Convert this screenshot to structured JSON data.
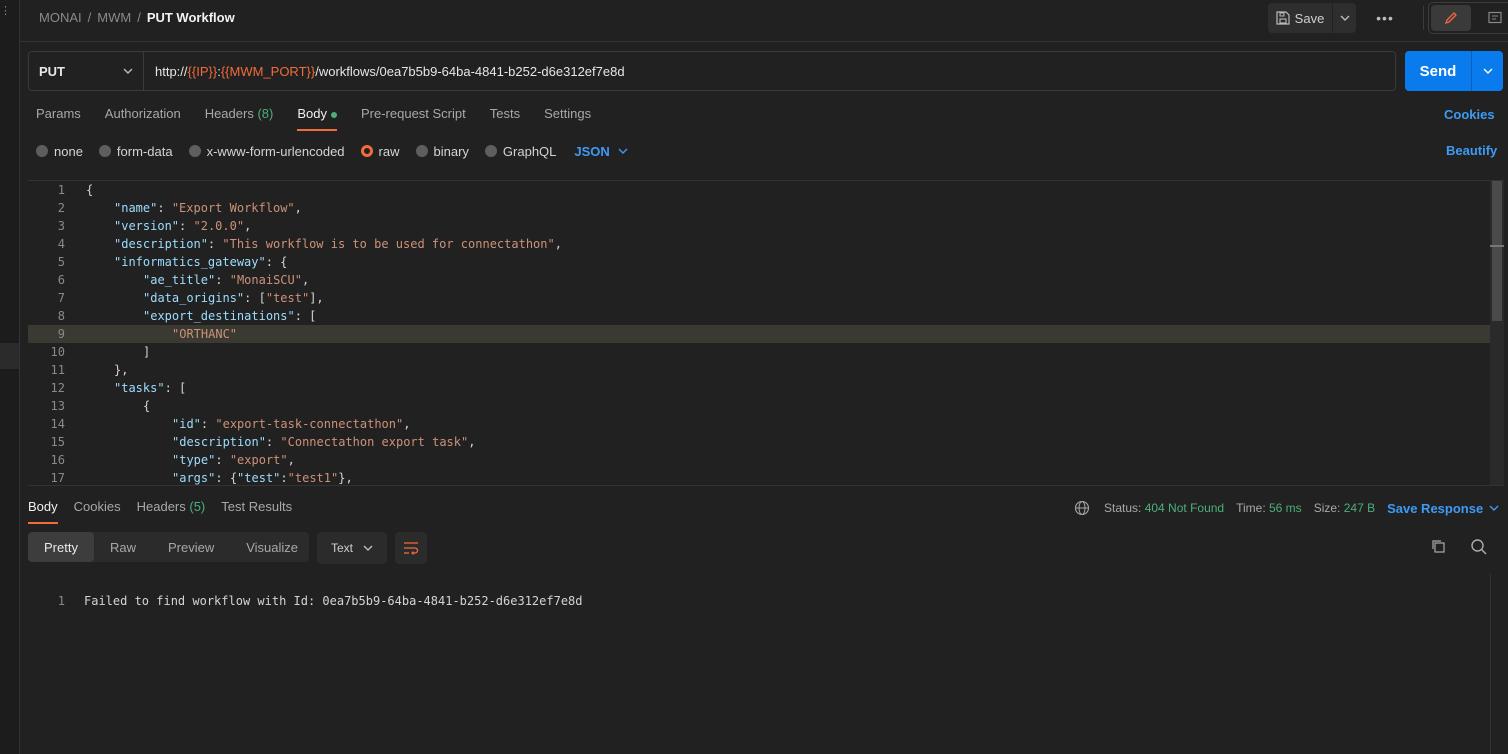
{
  "breadcrumb": {
    "part1": "MONAI",
    "part2": "MWM",
    "current": "PUT Workflow",
    "sep": "/"
  },
  "header": {
    "save_label": "Save",
    "more_label": "•••"
  },
  "request": {
    "method": "PUT",
    "url_prefix": "http://",
    "url_var1": "{{IP}}",
    "url_colon": ":",
    "url_var2": "{{MWM_PORT}}",
    "url_path": "/workflows/0ea7b5b9-64ba-4841-b252-d6e312ef7e8d",
    "send_label": "Send"
  },
  "req_tabs": {
    "params": "Params",
    "authorization": "Authorization",
    "headers": "Headers",
    "headers_count": "(8)",
    "body": "Body",
    "prerequest": "Pre-request Script",
    "tests": "Tests",
    "settings": "Settings",
    "cookies": "Cookies"
  },
  "body_options": {
    "none": "none",
    "form_data": "form-data",
    "urlencoded": "x-www-form-urlencoded",
    "raw": "raw",
    "binary": "binary",
    "graphql": "GraphQL",
    "language": "JSON",
    "beautify": "Beautify"
  },
  "editor_lines": [
    {
      "n": "1",
      "text": "{"
    },
    {
      "n": "2",
      "text": "\"name\": \"Export Workflow\","
    },
    {
      "n": "3",
      "text": "\"version\": \"2.0.0\","
    },
    {
      "n": "4",
      "text": "\"description\": \"This workflow is to be used for connectathon\","
    },
    {
      "n": "5",
      "text": "\"informatics_gateway\": {"
    },
    {
      "n": "6",
      "text": "\"ae_title\": \"MonaiSCU\","
    },
    {
      "n": "7",
      "text": "\"data_origins\": [\"test\"],"
    },
    {
      "n": "8",
      "text": "\"export_destinations\": ["
    },
    {
      "n": "9",
      "text": "\"ORTHANC\""
    },
    {
      "n": "10",
      "text": "]"
    },
    {
      "n": "11",
      "text": "},"
    },
    {
      "n": "12",
      "text": "\"tasks\": ["
    },
    {
      "n": "13",
      "text": "{"
    },
    {
      "n": "14",
      "text": "\"id\": \"export-task-connectathon\","
    },
    {
      "n": "15",
      "text": "\"description\": \"Connectathon export task\","
    },
    {
      "n": "16",
      "text": "\"type\": \"export\","
    },
    {
      "n": "17",
      "text": "\"args\": {\"test\":\"test1\"},"
    }
  ],
  "resp_tabs": {
    "body": "Body",
    "cookies": "Cookies",
    "headers": "Headers",
    "headers_count": "(5)",
    "test_results": "Test Results"
  },
  "response_meta": {
    "status_label": "Status:",
    "status_value": "404 Not Found",
    "time_label": "Time:",
    "time_value": "56 ms",
    "size_label": "Size:",
    "size_value": "247 B",
    "save_response": "Save Response"
  },
  "view_tabs": {
    "pretty": "Pretty",
    "raw": "Raw",
    "preview": "Preview",
    "visualize": "Visualize"
  },
  "format": "Text",
  "response_lines": [
    {
      "n": "1",
      "text": "Failed to find workflow with Id: 0ea7b5b9-64ba-4841-b252-d6e312ef7e8d"
    }
  ],
  "colors": {
    "accent": "#f26b3a",
    "primary": "#097bed",
    "success": "#4caf7a",
    "link": "#3d9bf5"
  }
}
